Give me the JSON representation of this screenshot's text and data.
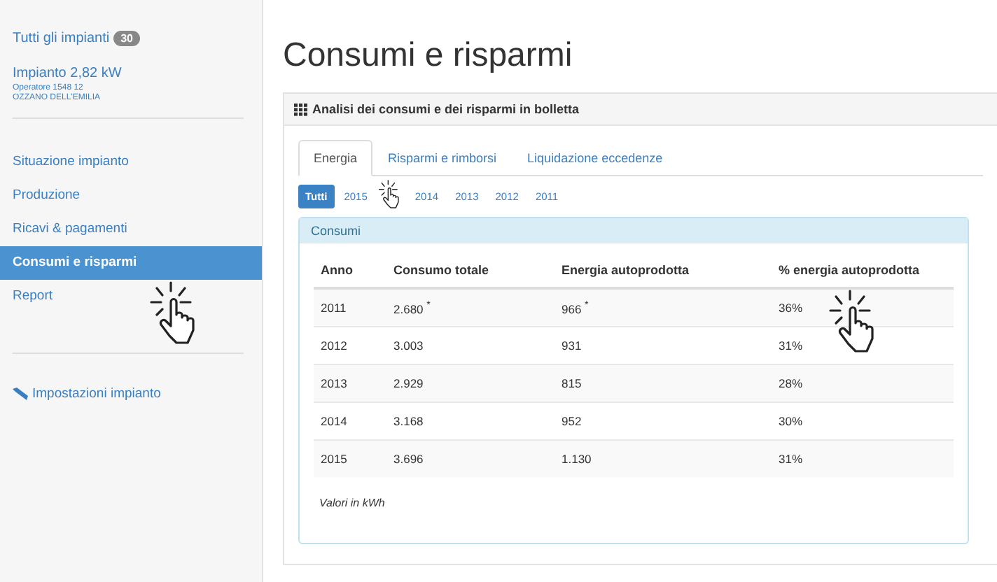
{
  "sidebar": {
    "all_link": "Tutti gli impianti",
    "all_count": "30",
    "plant": {
      "name": "Impianto 2,82 kW",
      "operator": "Operatore 1548 12",
      "location": "OZZANO DELL'EMILIA"
    },
    "items": [
      {
        "label": "Situazione impianto",
        "selected": false
      },
      {
        "label": "Produzione",
        "selected": false
      },
      {
        "label": "Ricavi & pagamenti",
        "selected": false
      },
      {
        "label": "Consumi e risparmi",
        "selected": true
      },
      {
        "label": "Report",
        "selected": false
      }
    ],
    "settings": "Impostazioni impianto"
  },
  "page_title": "Consumi e risparmi",
  "panel": {
    "title": "Analisi dei consumi e dei risparmi in bolletta",
    "tabs": [
      {
        "label": "Energia",
        "selected": true
      },
      {
        "label": "Risparmi e rimborsi",
        "selected": false
      },
      {
        "label": "Liquidazione eccedenze",
        "selected": false
      }
    ],
    "years": [
      {
        "label": "Tutti",
        "selected": true
      },
      {
        "label": "2015",
        "selected": false
      },
      {
        "label": "2014",
        "selected": false
      },
      {
        "label": "2013",
        "selected": false
      },
      {
        "label": "2012",
        "selected": false
      },
      {
        "label": "2011",
        "selected": false
      }
    ],
    "table": {
      "title": "Consumi",
      "columns": [
        "Anno",
        "Consumo totale",
        "Energia autoprodotta",
        "% energia autoprodotta"
      ],
      "rows": [
        [
          "2011",
          "2.680 $^{*}$",
          "966 $^{*}$",
          "36%"
        ],
        [
          "2012",
          "3.003",
          "931",
          "31%"
        ],
        [
          "2013",
          "2.929",
          "815",
          "28%"
        ],
        [
          "2014",
          "3.168",
          "952",
          "30%"
        ],
        [
          "2015",
          "3.696",
          "1.130",
          "31%"
        ]
      ],
      "note": "Valori in kWh"
    }
  }
}
